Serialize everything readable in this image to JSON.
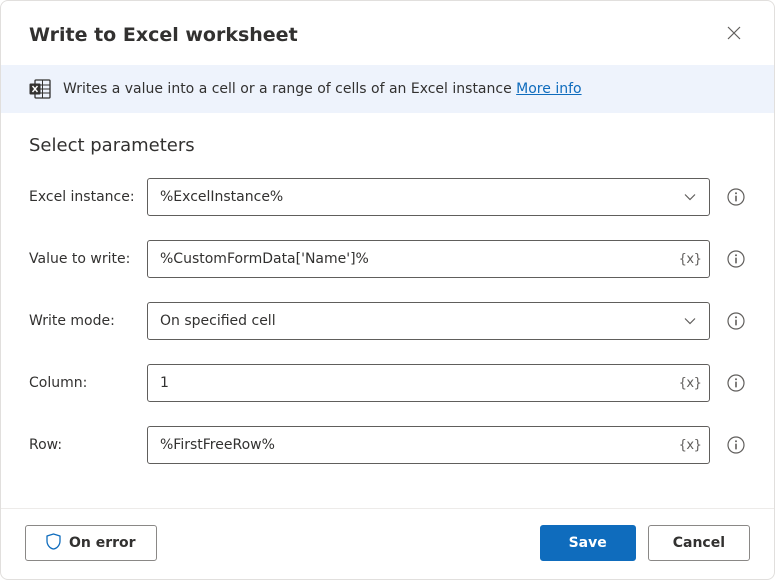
{
  "header": {
    "title": "Write to Excel worksheet"
  },
  "banner": {
    "text": "Writes a value into a cell or a range of cells of an Excel instance",
    "link_label": "More info"
  },
  "section": {
    "title": "Select parameters"
  },
  "fields": {
    "excel_instance": {
      "label": "Excel instance:",
      "value": "%ExcelInstance%",
      "type": "dropdown"
    },
    "value_to_write": {
      "label": "Value to write:",
      "value": "%CustomFormData['Name']%",
      "type": "expression"
    },
    "write_mode": {
      "label": "Write mode:",
      "value": "On specified cell",
      "type": "dropdown"
    },
    "column": {
      "label": "Column:",
      "value": "1",
      "type": "expression"
    },
    "row": {
      "label": "Row:",
      "value": "%FirstFreeRow%",
      "type": "expression"
    }
  },
  "footer": {
    "on_error": "On error",
    "save": "Save",
    "cancel": "Cancel"
  }
}
